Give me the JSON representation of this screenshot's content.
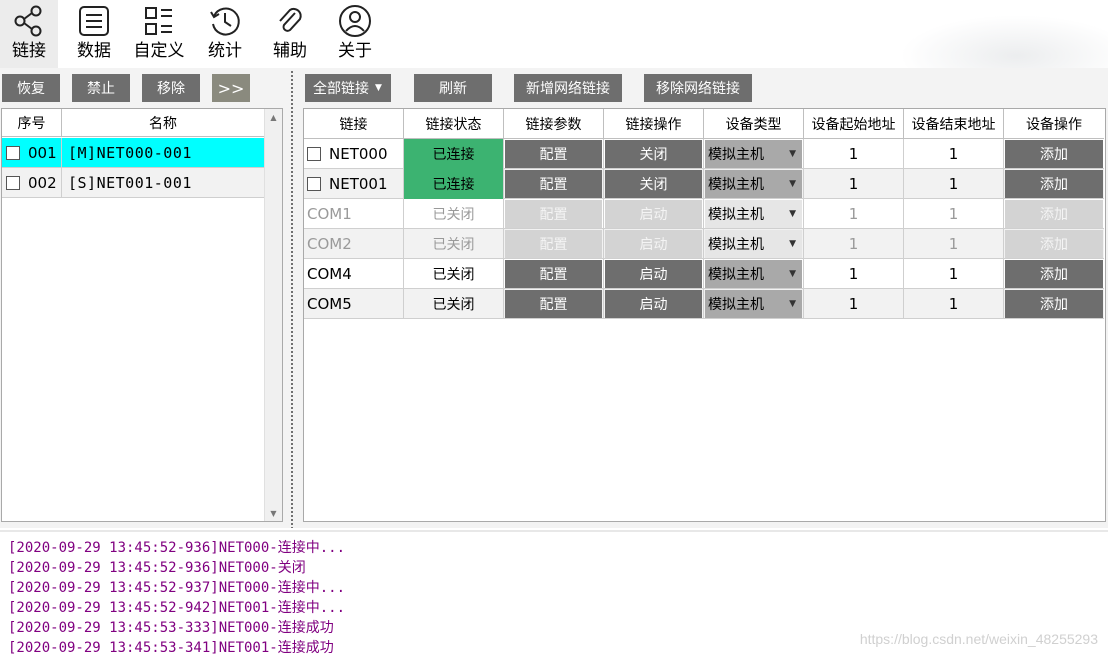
{
  "nav": [
    {
      "label": "链接",
      "icon": "share-icon",
      "active": true
    },
    {
      "label": "数据",
      "icon": "list-icon"
    },
    {
      "label": "自定义",
      "icon": "grid-icon"
    },
    {
      "label": "统计",
      "icon": "history-icon"
    },
    {
      "label": "辅助",
      "icon": "paperclip-icon"
    },
    {
      "label": "关于",
      "icon": "user-icon"
    }
  ],
  "left_toolbar": {
    "restore": "恢复",
    "disable": "禁止",
    "remove": "移除",
    "expand": ">>"
  },
  "right_toolbar": {
    "all_links": "全部链接",
    "refresh": "刷新",
    "add_net": "新增网络链接",
    "remove_net": "移除网络链接"
  },
  "left_table": {
    "headers": [
      "序号",
      "名称"
    ],
    "rows": [
      {
        "no": "001",
        "name": "[M]NET000-001"
      },
      {
        "no": "002",
        "name": "[S]NET001-001"
      }
    ]
  },
  "right_table": {
    "headers": [
      "链接",
      "链接状态",
      "链接参数",
      "链接操作",
      "设备类型",
      "设备起始地址",
      "设备结束地址",
      "设备操作"
    ],
    "rows": [
      {
        "link": "NET000",
        "status": "已连接",
        "param": "配置",
        "op": "关闭",
        "type": "模拟主机",
        "start": "1",
        "end": "1",
        "dev_op": "添加"
      },
      {
        "link": "NET001",
        "status": "已连接",
        "param": "配置",
        "op": "关闭",
        "type": "模拟主机",
        "start": "1",
        "end": "1",
        "dev_op": "添加"
      },
      {
        "link": "COM1",
        "status": "已关闭",
        "param": "配置",
        "op": "启动",
        "type": "模拟主机",
        "start": "1",
        "end": "1",
        "dev_op": "添加"
      },
      {
        "link": "COM2",
        "status": "已关闭",
        "param": "配置",
        "op": "启动",
        "type": "模拟主机",
        "start": "1",
        "end": "1",
        "dev_op": "添加"
      },
      {
        "link": "COM4",
        "status": "已关闭",
        "param": "配置",
        "op": "启动",
        "type": "模拟主机",
        "start": "1",
        "end": "1",
        "dev_op": "添加"
      },
      {
        "link": "COM5",
        "status": "已关闭",
        "param": "配置",
        "op": "启动",
        "type": "模拟主机",
        "start": "1",
        "end": "1",
        "dev_op": "添加"
      }
    ]
  },
  "log": [
    "[2020-09-29 13:45:52-936]NET000-连接中...",
    "[2020-09-29 13:45:52-936]NET000-关闭",
    "[2020-09-29 13:45:52-937]NET000-连接中...",
    "[2020-09-29 13:45:52-942]NET001-连接中...",
    "[2020-09-29 13:45:53-333]NET000-连接成功",
    "[2020-09-29 13:45:53-341]NET001-连接成功"
  ],
  "watermark": "https://blog.csdn.net/weixin_48255293",
  "colors": {
    "connected": "#3cb371",
    "selected_row": "#00ffff",
    "button": "#6e6e6e",
    "log_text": "#800080"
  }
}
